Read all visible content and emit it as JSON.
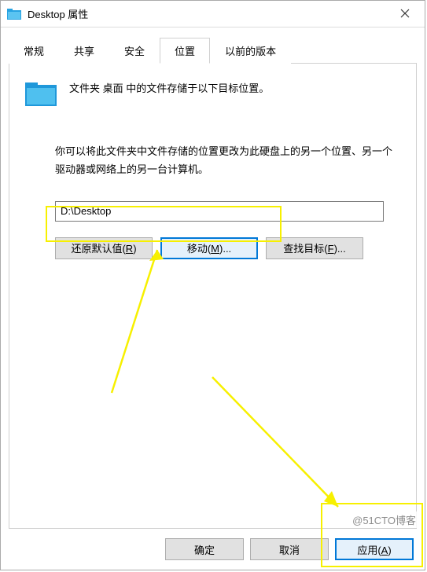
{
  "window": {
    "title": "Desktop 属性"
  },
  "tabs": {
    "general": "常规",
    "sharing": "共享",
    "security": "安全",
    "location": "位置",
    "previous": "以前的版本"
  },
  "content": {
    "intro": "文件夹 桌面 中的文件存储于以下目标位置。",
    "description": "你可以将此文件夹中文件存储的位置更改为此硬盘上的另一个位置、另一个驱动器或网络上的另一台计算机。",
    "path_value": "D:\\Desktop"
  },
  "buttons": {
    "restore_pre": "还原默认值(",
    "restore_key": "R",
    "restore_post": ")",
    "move_pre": "移动(",
    "move_key": "M",
    "move_post": ")...",
    "find_pre": "查找目标(",
    "find_key": "F",
    "find_post": ")...",
    "ok": "确定",
    "cancel": "取消",
    "apply_pre": "应用(",
    "apply_key": "A",
    "apply_post": ")"
  },
  "watermark": "@51CTO博客"
}
